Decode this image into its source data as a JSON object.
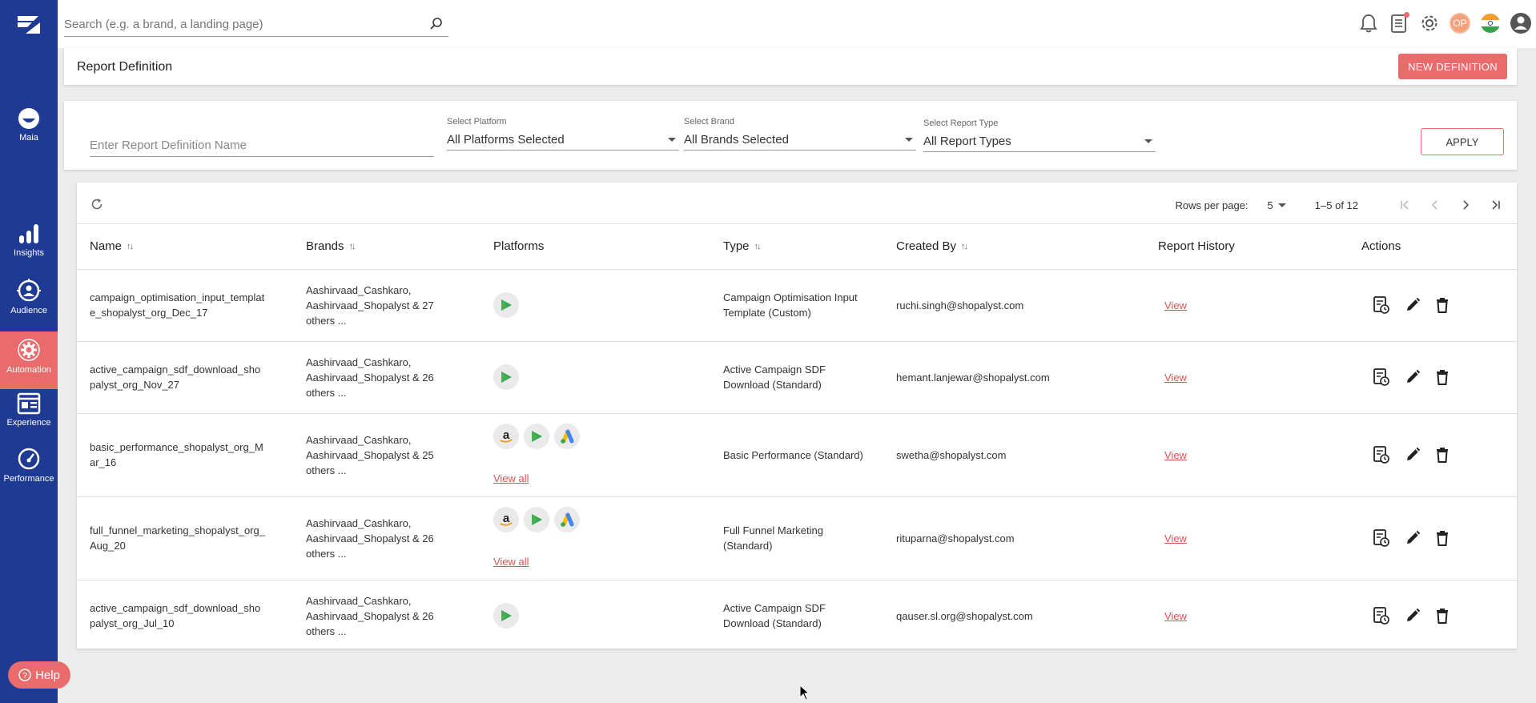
{
  "search": {
    "placeholder": "Search (e.g. a brand, a landing page)"
  },
  "sidebar": {
    "items": [
      {
        "label": "Maia"
      },
      {
        "label": "Insights"
      },
      {
        "label": "Audience"
      },
      {
        "label": "Automation"
      },
      {
        "label": "Experience"
      },
      {
        "label": "Performance"
      }
    ],
    "help_label": "Help"
  },
  "topbar": {
    "avatar_initials": "OP"
  },
  "header": {
    "title": "Report Definition",
    "new_button": "NEW DEFINITION"
  },
  "filters": {
    "name_placeholder": "Enter Report Definition Name",
    "platform": {
      "label": "Select Platform",
      "value": "All Platforms Selected"
    },
    "brand": {
      "label": "Select Brand",
      "value": "All Brands Selected"
    },
    "report_type": {
      "label": "Select Report Type",
      "value": "All Report Types"
    },
    "apply_label": "APPLY"
  },
  "pagination": {
    "rows_label": "Rows per page:",
    "rows_value": "5",
    "range": "1–5 of 12"
  },
  "table": {
    "columns": [
      "Name",
      "Brands",
      "Platforms",
      "Type",
      "Created By",
      "Report History",
      "Actions"
    ],
    "rows": [
      {
        "name_l1": "campaign_optimisation_input_templat",
        "name_l2": "e_shopalyst_org_Dec_17",
        "brands_l1": "Aashirvaad_Cashkaro,",
        "brands_l2": "Aashirvaad_Shopalyst & 27",
        "brands_l3": "others ...",
        "platforms": [
          "play-icon"
        ],
        "type_l1": "Campaign Optimisation Input",
        "type_l2": "Template (Custom)",
        "created_by": "ruchi.singh@shopalyst.com",
        "history": "View"
      },
      {
        "name_l1": "active_campaign_sdf_download_sho",
        "name_l2": "palyst_org_Nov_27",
        "brands_l1": "Aashirvaad_Cashkaro,",
        "brands_l2": "Aashirvaad_Shopalyst & 26",
        "brands_l3": "others ...",
        "platforms": [
          "play-icon"
        ],
        "type_l1": "Active Campaign SDF",
        "type_l2": "Download (Standard)",
        "created_by": "hemant.lanjewar@shopalyst.com",
        "history": "View"
      },
      {
        "name_l1": "basic_performance_shopalyst_org_M",
        "name_l2": "ar_16",
        "brands_l1": "Aashirvaad_Cashkaro,",
        "brands_l2": "Aashirvaad_Shopalyst & 25",
        "brands_l3": "others ...",
        "platforms": [
          "amazon-icon",
          "play-icon",
          "google-ads-icon"
        ],
        "view_all": "View all",
        "type_l1": "Basic Performance (Standard)",
        "type_l2": "",
        "created_by": "swetha@shopalyst.com",
        "history": "View"
      },
      {
        "name_l1": "full_funnel_marketing_shopalyst_org_",
        "name_l2": "Aug_20",
        "brands_l1": "Aashirvaad_Cashkaro,",
        "brands_l2": "Aashirvaad_Shopalyst & 26",
        "brands_l3": "others ...",
        "platforms": [
          "amazon-icon",
          "play-icon",
          "google-ads-icon"
        ],
        "view_all": "View all",
        "type_l1": "Full Funnel Marketing",
        "type_l2": "(Standard)",
        "created_by": "rituparna@shopalyst.com",
        "history": "View"
      },
      {
        "name_l1": "active_campaign_sdf_download_sho",
        "name_l2": "palyst_org_Jul_10",
        "brands_l1": "Aashirvaad_Cashkaro,",
        "brands_l2": "Aashirvaad_Shopalyst & 26",
        "brands_l3": "others ...",
        "platforms": [
          "play-icon"
        ],
        "type_l1": "Active Campaign SDF",
        "type_l2": "Download (Standard)",
        "created_by": "qauser.sl.org@shopalyst.com",
        "history": "View"
      }
    ]
  },
  "colors": {
    "sidebar": "#1f3a93",
    "accent": "#e96b6b",
    "link": "#d9534f"
  }
}
